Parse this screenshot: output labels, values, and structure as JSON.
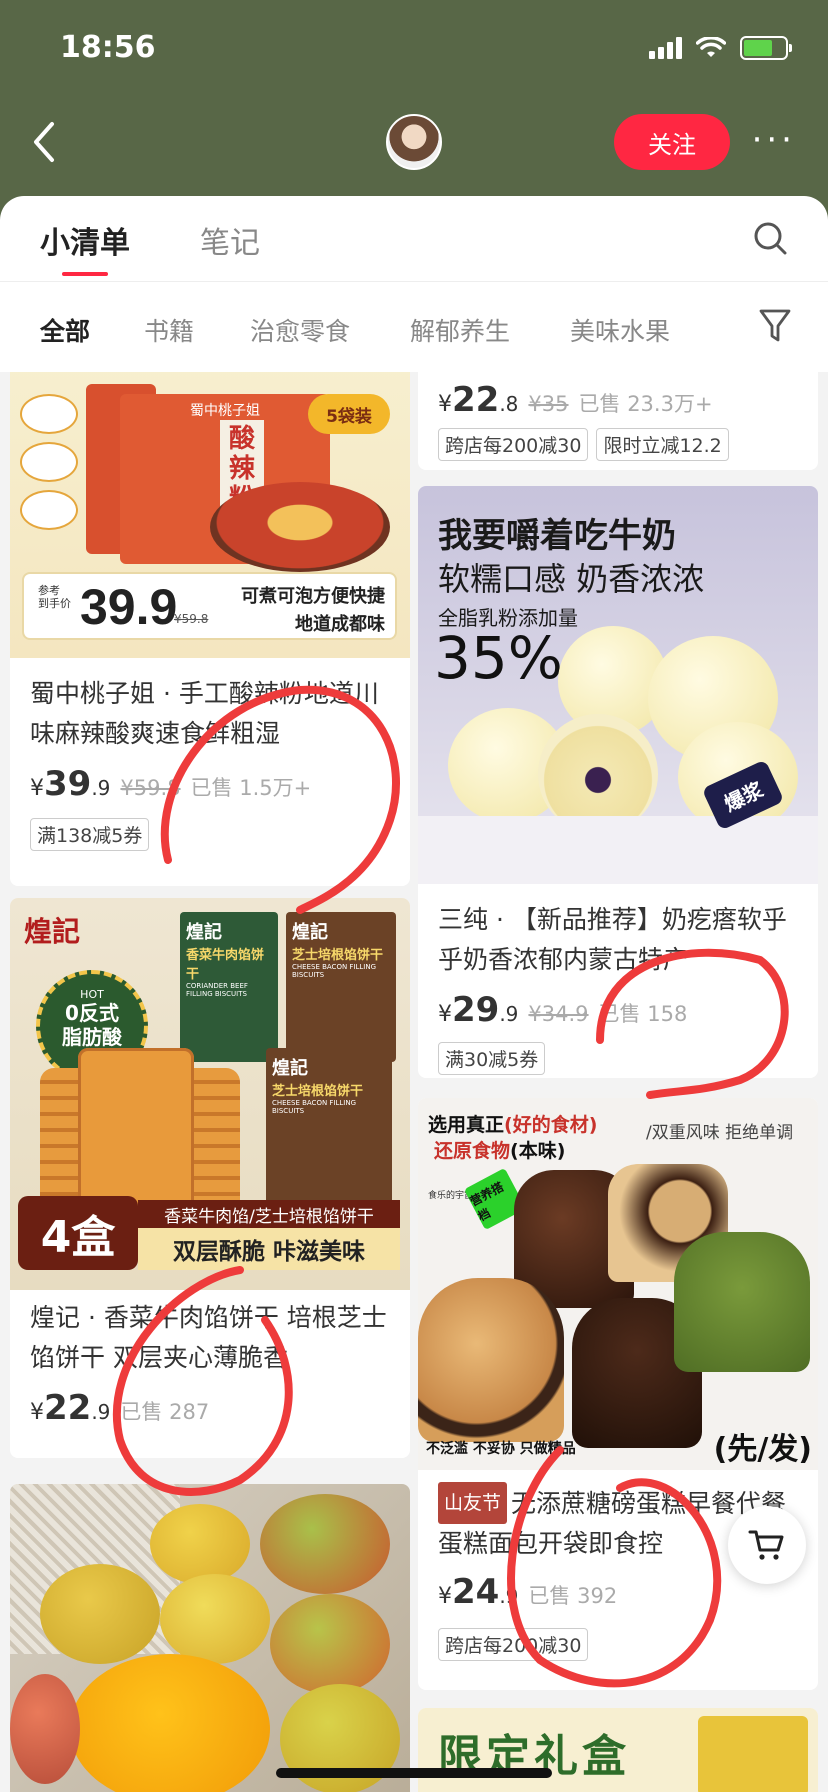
{
  "status_bar": {
    "time": "18:56"
  },
  "navbar": {
    "follow_label": "关注",
    "more_label": "···"
  },
  "main_tabs": [
    {
      "label": "小清单",
      "active": true
    },
    {
      "label": "笔记",
      "active": false
    }
  ],
  "category_tabs": [
    {
      "label": "全部",
      "active": true
    },
    {
      "label": "书籍",
      "active": false
    },
    {
      "label": "治愈零食",
      "active": false
    },
    {
      "label": "解郁养生",
      "active": false
    },
    {
      "label": "美味水果",
      "active": false
    }
  ],
  "products": {
    "top_right": {
      "price_int": "22",
      "price_dec": ".8",
      "orig": "¥35",
      "sold": "已售 23.3万+",
      "coupons": [
        "跨店每200减30",
        "限时立减12.2"
      ]
    },
    "noodles": {
      "img": {
        "brand": "蜀中桃子姐",
        "name": "酸辣粉",
        "bag_count": "5袋装",
        "ref_label": "参考\n到手价",
        "ref_price": "39.9",
        "ref_orig": "¥59.8",
        "slogan_1": "可煮可泡方便快捷",
        "slogan_2": "地道成都味"
      },
      "title": "蜀中桃子姐 · 手工酸辣粉地道川味麻辣酸爽速食鲜粗湿",
      "price_int": "39",
      "price_dec": ".9",
      "orig": "¥59.8",
      "sold": "已售 1.5万+",
      "coupons": [
        "满138减5券"
      ]
    },
    "milk": {
      "img": {
        "line_1": "我要嚼着吃牛奶",
        "line_2": "软糯口感 奶香浓浓",
        "line_3": "全脂乳粉添加量",
        "percent": "35%",
        "tag": "爆浆"
      },
      "title": "三纯 · 【新品推荐】奶疙瘩软乎乎奶香浓郁内蒙古特产",
      "price_int": "29",
      "price_dec": ".9",
      "orig": "¥34.9",
      "sold": "已售 158",
      "coupons": [
        "满30减5券"
      ]
    },
    "biscuit": {
      "img": {
        "brand": "煌記",
        "hot": "HOT",
        "hot_1": "0反式",
        "hot_2": "脂肪酸",
        "box_1": "香菜牛肉馅饼干",
        "box_2": "芝士培根馅饼干",
        "box_1_en": "CORIANDER BEEF FILLING BISCUITS",
        "box_2_en": "CHEESE BACON FILLING BISCUITS",
        "count": "4盒",
        "strip_1": "香菜牛肉馅/芝士培根馅饼干",
        "strip_2": "双层酥脆 咔滋美味"
      },
      "title": "煌记 · 香菜牛肉馅饼干 培根芝士馅饼干 双层夹心薄脆香",
      "price_int": "22",
      "price_dec": ".9",
      "sold": "已售 287"
    },
    "cake": {
      "img": {
        "head_1": "选用真正",
        "head_1b": "(好的食材)",
        "head_2": "还原食物",
        "head_2b": "(本味)",
        "right": "/双重风味 拒绝单调",
        "tag": "营养搭档",
        "bottom": "不泛滥 不妥协 只做精品",
        "ship": "(先/发)",
        "brand": "食乐的宇宙"
      },
      "badge": "山友节",
      "title": "无添蔗糖磅蛋糕早餐代餐蛋糕面包开袋即食控",
      "price_int": "24",
      "price_dec": ".9",
      "sold": "已售 392",
      "coupons": [
        "跨店每200减30"
      ]
    },
    "bottom_right": {
      "img_text": "限定礼盒"
    }
  },
  "colors": {
    "header_bg": "#586747",
    "accent": "#ff2742",
    "annotation": "#ee3b3b"
  }
}
